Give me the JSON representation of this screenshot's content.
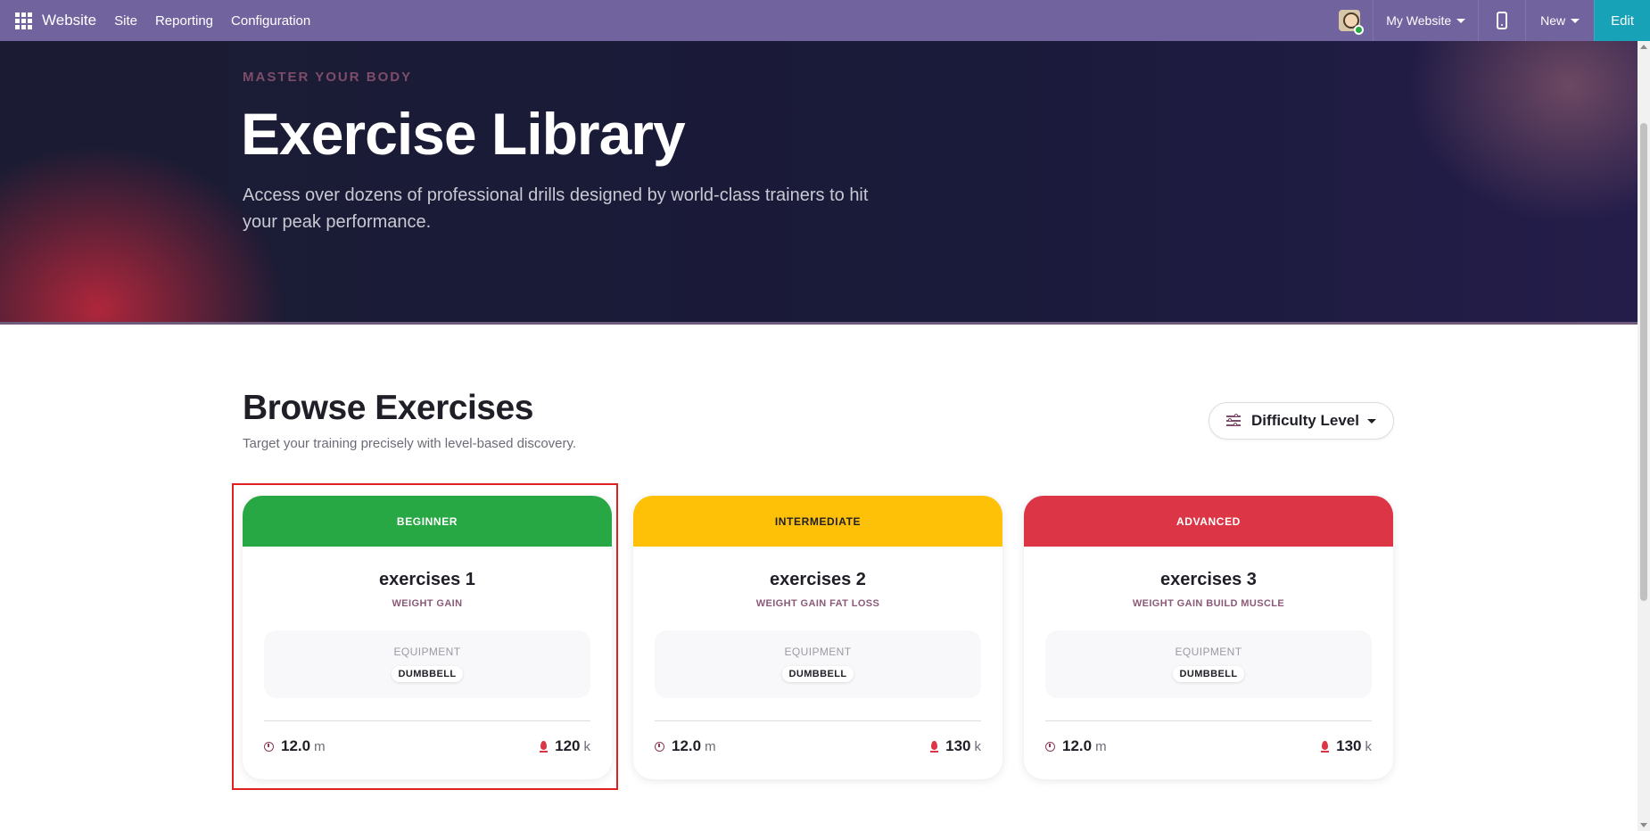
{
  "navbar": {
    "brand": "Website",
    "menu": [
      "Site",
      "Reporting",
      "Configuration"
    ],
    "website_selector": "My Website",
    "new_label": "New",
    "edit_label": "Edit",
    "color": "#71639e",
    "edit_color": "#17a2b8"
  },
  "hero": {
    "eyebrow": "MASTER YOUR BODY",
    "title": "Exercise Library",
    "subtitle": "Access over dozens of professional drills designed by world-class trainers to hit your peak performance."
  },
  "browse": {
    "title": "Browse Exercises",
    "subtitle": "Target your training precisely with level-based discovery.",
    "filter_label": "Difficulty Level"
  },
  "cards": [
    {
      "level": "BEGINNER",
      "level_color": "#28a745",
      "level_text_color": "#ffffff",
      "title": "exercises 1",
      "tag": "WEIGHT GAIN",
      "equipment_label": "EQUIPMENT",
      "equipment": "DUMBBELL",
      "duration": "12.0",
      "duration_unit": "m",
      "calories": "120",
      "calories_unit": "k"
    },
    {
      "level": "INTERMEDIATE",
      "level_color": "#ffc107",
      "level_text_color": "#1f1f28",
      "title": "exercises 2",
      "tag": "WEIGHT GAIN FAT LOSS",
      "equipment_label": "EQUIPMENT",
      "equipment": "DUMBBELL",
      "duration": "12.0",
      "duration_unit": "m",
      "calories": "130",
      "calories_unit": "k"
    },
    {
      "level": "ADVANCED",
      "level_color": "#dc3545",
      "level_text_color": "#ffffff",
      "title": "exercises 3",
      "tag": "WEIGHT GAIN BUILD MUSCLE",
      "equipment_label": "EQUIPMENT",
      "equipment": "DUMBBELL",
      "duration": "12.0",
      "duration_unit": "m",
      "calories": "130",
      "calories_unit": "k"
    }
  ]
}
